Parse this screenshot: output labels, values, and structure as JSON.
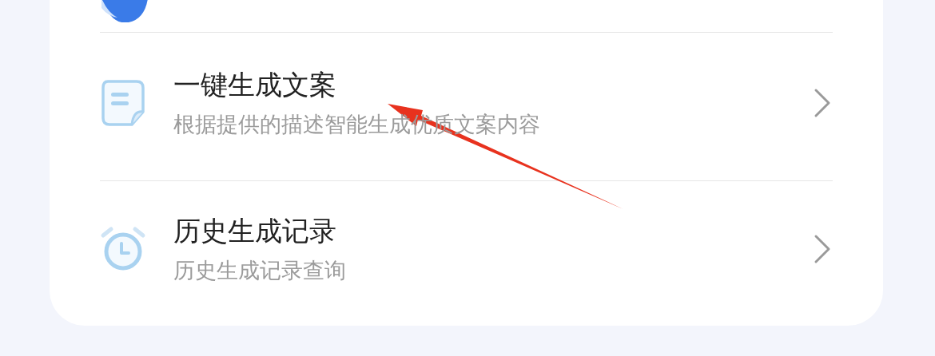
{
  "menu_items": [
    {
      "title": "一键生成文案",
      "subtitle": "根据提供的描述智能生成优质文案内容"
    },
    {
      "title": "历史生成记录",
      "subtitle": "历史生成记录查询"
    }
  ]
}
